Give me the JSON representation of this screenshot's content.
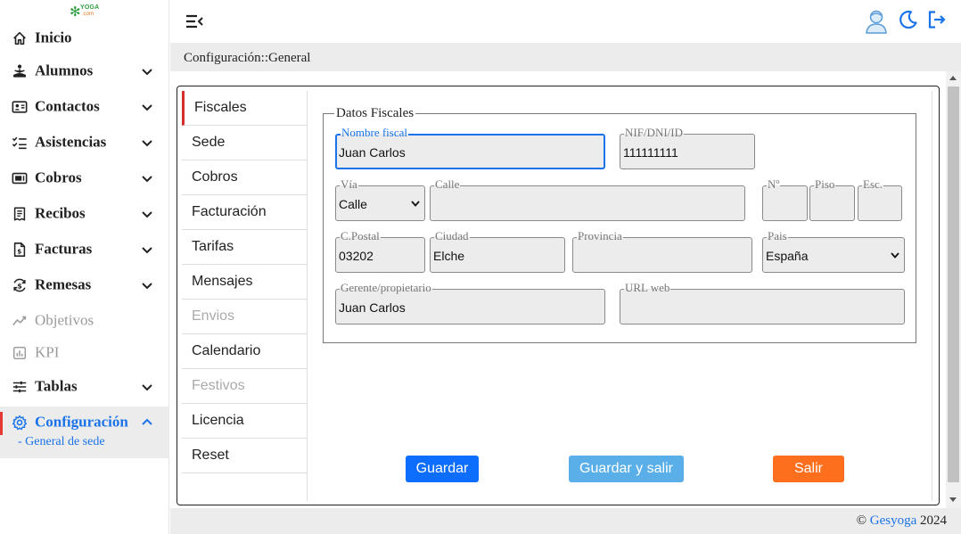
{
  "logo": {
    "yoga": "YOGA",
    "com": ".com"
  },
  "sidebar": {
    "items": [
      {
        "label": "Inicio"
      },
      {
        "label": "Alumnos"
      },
      {
        "label": "Contactos"
      },
      {
        "label": "Asistencias"
      },
      {
        "label": "Cobros"
      },
      {
        "label": "Recibos"
      },
      {
        "label": "Facturas"
      },
      {
        "label": "Remesas"
      },
      {
        "label": "Objetivos"
      },
      {
        "label": "KPI"
      },
      {
        "label": "Tablas"
      },
      {
        "label": "Configuración",
        "subitem": "- General de sede"
      }
    ]
  },
  "breadcrumb": "Configuración::General",
  "tabs": [
    {
      "label": "Fiscales",
      "active": true
    },
    {
      "label": "Sede"
    },
    {
      "label": "Cobros"
    },
    {
      "label": "Facturación"
    },
    {
      "label": "Tarifas"
    },
    {
      "label": "Mensajes"
    },
    {
      "label": "Envios",
      "disabled": true
    },
    {
      "label": "Calendario"
    },
    {
      "label": "Festivos",
      "disabled": true
    },
    {
      "label": "Licencia"
    },
    {
      "label": "Reset"
    }
  ],
  "form": {
    "legend": "Datos Fiscales",
    "nombre_fiscal": {
      "label": "Nombre fiscal",
      "value": "Juan Carlos"
    },
    "nif": {
      "label": "NIF/DNI/ID",
      "value": "111111111"
    },
    "via": {
      "label": "Vía",
      "value": "Calle"
    },
    "calle": {
      "label": "Calle",
      "value": ""
    },
    "numero": {
      "label": "Nº",
      "value": ""
    },
    "piso": {
      "label": "Piso",
      "value": ""
    },
    "escalera": {
      "label": "Esc.",
      "value": ""
    },
    "cpostal": {
      "label": "C.Postal",
      "value": "03202"
    },
    "ciudad": {
      "label": "Ciudad",
      "value": "Elche"
    },
    "provincia": {
      "label": "Provincia",
      "value": ""
    },
    "pais": {
      "label": "Pais",
      "value": "España"
    },
    "gerente": {
      "label": "Gerente/propietario",
      "value": "Juan Carlos"
    },
    "url": {
      "label": "URL web",
      "value": ""
    }
  },
  "buttons": {
    "guardar": "Guardar",
    "guardar_salir": "Guardar y salir",
    "salir": "Salir"
  },
  "footer": {
    "copyright": "©",
    "brand": "Gesyoga",
    "year": "2024"
  },
  "colors": {
    "accent": "#1a73e8",
    "primary_button": "#0d6efd",
    "secondary_button": "#5aafe8",
    "danger_button": "#fd6e1d",
    "active_marker": "#d32f2f"
  }
}
